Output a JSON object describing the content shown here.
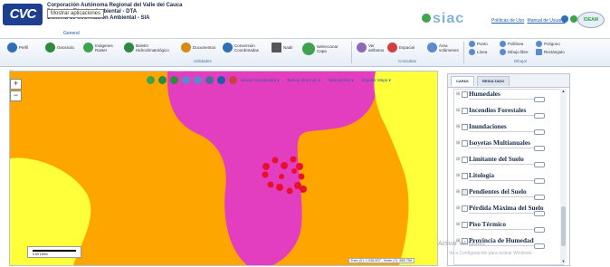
{
  "header": {
    "logo": "CVC",
    "tooltip": "Mostrar aplicaciones",
    "title_line1": "Corporación Autónoma Regional del Valle del Cauca",
    "title_line2": "Dirección Técnica Ambiental - DTA",
    "title_line3": "Sistema de Información Ambiental - SIA",
    "general_tab": "General",
    "siac": "siac",
    "link_policies": "Políticas de Uso",
    "link_manual": "Manual de Usuario",
    "ideam": "IDEAM"
  },
  "toolbar": {
    "items": [
      {
        "label": "Perfil",
        "color": "#2f6fb8"
      },
      {
        "label": "Geosicdo",
        "color": "#2e8a3e"
      },
      {
        "label": "Imágenes Raster",
        "color": "#3fa34d"
      },
      {
        "label": "Boletín Hidroclimatológico",
        "color": "#2e8a3e"
      },
      {
        "label": "Documentos",
        "color": "#d98a10"
      },
      {
        "label": "Conversión Coordenadas",
        "color": "#2f6fb8"
      },
      {
        "label": "Nadir",
        "color": "#555555"
      },
      {
        "label": "Seleccionar Capa",
        "color": "#3fa34d"
      },
      {
        "label": "Ver atributos",
        "color": "#8a6bb8"
      },
      {
        "label": "Espacial",
        "color": "#d04040"
      },
      {
        "label": "Área volúmenes",
        "color": "#5a8ad0"
      },
      {
        "label": "Punto",
        "color": "#5a8ad0"
      },
      {
        "label": "Polilínea",
        "color": "#5a8ad0"
      },
      {
        "label": "Polígono",
        "color": "#5a8ad0"
      },
      {
        "label": "Línea",
        "color": "#5a8ad0"
      },
      {
        "label": "Dibujo libre",
        "color": "#5a8ad0"
      },
      {
        "label": "Rectángulo",
        "color": "#5a8ad0"
      }
    ],
    "group_utilidades": "Utilidades",
    "group_consultas": "Consultas",
    "group_dibujar": "Dibujar"
  },
  "map_toolbar": {
    "ubicar_coordenada": "Ubicar Coordenada ▾",
    "buscar_direccion": "Buscar dirección ▾",
    "marcadores": "Marcadores ▾",
    "imprimir_mapa": "Imprimir Mapa ▾"
  },
  "map": {
    "zoom_in": "+",
    "zoom_out": "−",
    "scale_labels": "0      50      100m",
    "coordinates": "Este (X): 1.036.507 , Norte (Y): 885.756",
    "colors": {
      "orange": "#ffa500",
      "magenta": "#e33ec0",
      "yellow": "#ffff3a",
      "red": "#e8102c"
    }
  },
  "panel": {
    "tabs": [
      "CAPAS",
      "RESULTADO"
    ],
    "layers": [
      {
        "name": "Humedales",
        "checked": false
      },
      {
        "name": "Incendios Forestales",
        "checked": false
      },
      {
        "name": "Inundaciones",
        "checked": false
      },
      {
        "name": "Isoyetas Multianuales",
        "checked": false
      },
      {
        "name": "Limitante del Suelo",
        "checked": false
      },
      {
        "name": "Litología",
        "checked": false
      },
      {
        "name": "Pendientes del Suelo",
        "checked": true
      },
      {
        "name": "Pérdida Máxima del Suelo",
        "checked": false
      },
      {
        "name": "Piso Térmico",
        "checked": false
      },
      {
        "name": "Provincia de Humedad",
        "checked": false
      }
    ]
  },
  "watermark": {
    "line1": "Activar Windows",
    "line2": "Ve a Configuración para activar Windows."
  }
}
